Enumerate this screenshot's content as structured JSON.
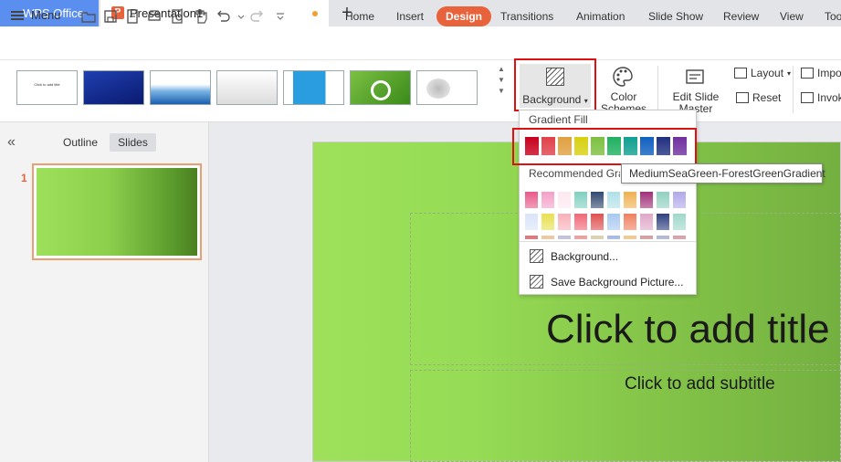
{
  "titlebar": {
    "app_tab": "WPS Office",
    "doc_tab": "Presentation1",
    "new_tab_symbol": "+",
    "doc_icon_letter": "P"
  },
  "menubar": {
    "menu_label": "Menu",
    "tabs": [
      "Home",
      "Insert",
      "Design",
      "Transitions",
      "Animation",
      "Slide Show",
      "Review",
      "View",
      "Tools"
    ],
    "active_tab": "Design"
  },
  "ribbon": {
    "background_label": "Background",
    "color_schemes_label": "Color Schemes",
    "edit_slide_master_label": "Edit Slide Master",
    "layout_label": "Layout",
    "reset_label": "Reset",
    "import_label": "Import",
    "invoke_label": "Invoke",
    "theme_thumb_text": "Click to add title"
  },
  "left_panel": {
    "outline_tab": "Outline",
    "slides_tab": "Slides",
    "slide_number": "1"
  },
  "slide": {
    "title_placeholder": "Click to add title",
    "subtitle_placeholder": "Click to add subtitle"
  },
  "dropdown": {
    "gradient_fill_label": "Gradient Fill",
    "gradient_swatches": [
      "#c8001e",
      "#e0404a",
      "#e0a040",
      "#d8d010",
      "#7cc040",
      "#20b060",
      "#10a090",
      "#1060c0",
      "#203080",
      "#7030a0"
    ],
    "recommended_label": "Recommended Gradient",
    "recommended_swatches": [
      [
        "#e85a8a",
        "#f4a0c8",
        "#fde8f0",
        "#80d0c0",
        "#304870",
        "#b0e0e8",
        "#f0b050",
        "#a03078",
        "#90d0c0",
        "#b0a8e8"
      ],
      [
        "#d8e4f8",
        "#e8e050",
        "#f8b0b8",
        "#f06878",
        "#e05050",
        "#a8c8f0",
        "#f08060",
        "#e0a8c8",
        "#304080",
        "#a0d8c8"
      ],
      [
        "#d87878",
        "#e8c8a0",
        "#c0c0d8",
        "#e8a0a0",
        "#d8d0b0",
        "#a8b8e0",
        "#f0c890",
        "#d0a0a0",
        "#b0b8d0",
        "#d8a0a8"
      ]
    ],
    "background_item": "Background...",
    "save_bg_item": "Save Background Picture..."
  },
  "tooltip": {
    "text": "MediumSeaGreen-ForestGreenGradient"
  },
  "colors": {
    "accent": "#e8623b",
    "wps_blue": "#5a8ff0",
    "highlight_red": "#e01010"
  }
}
